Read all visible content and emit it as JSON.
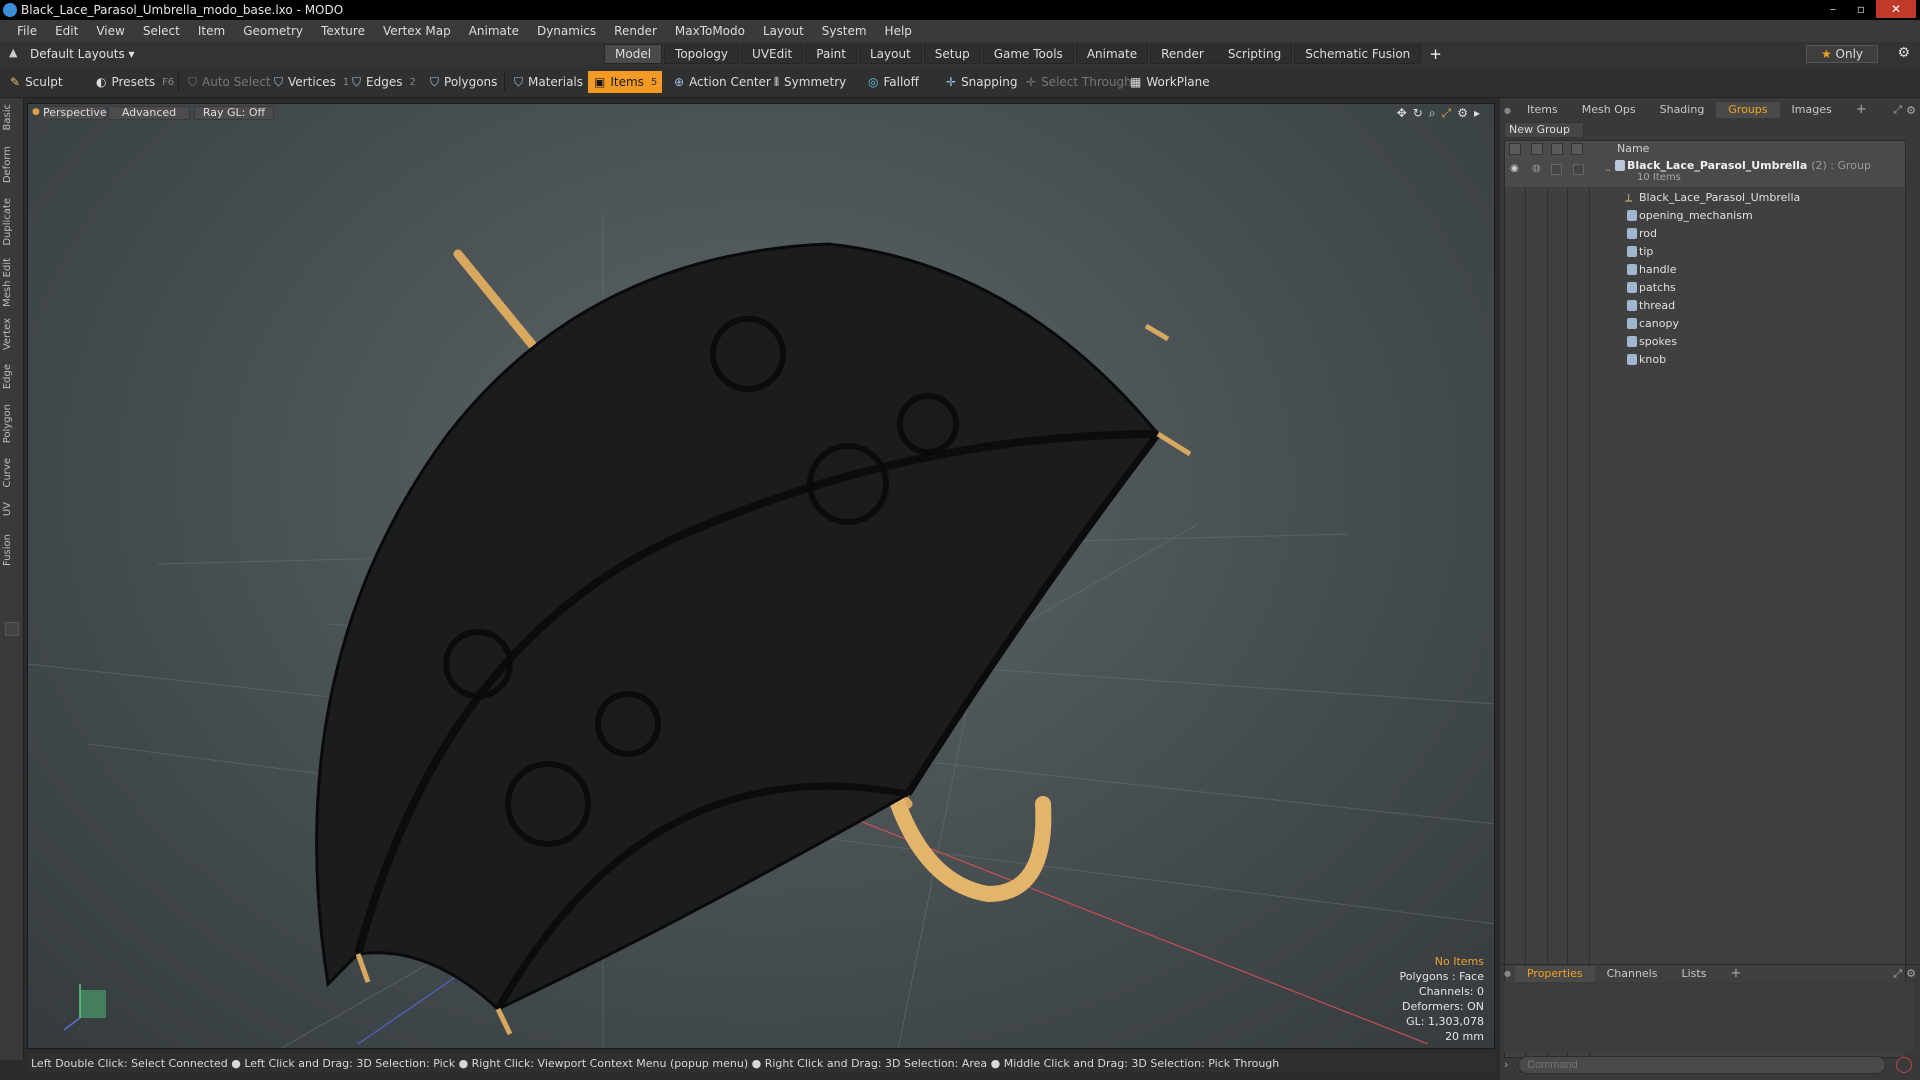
{
  "window": {
    "title": "Black_Lace_Parasol_Umbrella_modo_base.lxo - MODO",
    "controls": [
      "–",
      "▫",
      "✕"
    ]
  },
  "menu": [
    "File",
    "Edit",
    "View",
    "Select",
    "Item",
    "Geometry",
    "Texture",
    "Vertex Map",
    "Animate",
    "Dynamics",
    "Render",
    "MaxToModo",
    "Layout",
    "System",
    "Help"
  ],
  "layout": {
    "selector": "Default Layouts",
    "tabs": [
      "Model",
      "Topology",
      "UVEdit",
      "Paint",
      "Layout",
      "Setup",
      "Game Tools",
      "Animate",
      "Render",
      "Scripting",
      "Schematic Fusion"
    ],
    "active_tab": "Model",
    "plus": "+",
    "only_label": "Only"
  },
  "toolbar": {
    "sculpt": "Sculpt",
    "presets": "Presets",
    "presets_key": "F6",
    "auto_select": "Auto Select",
    "vertices": "Vertices",
    "vertices_count": "1",
    "edges": "Edges",
    "edges_count": "2",
    "polygons": "Polygons",
    "materials": "Materials",
    "items": "Items",
    "items_count": "5",
    "action_center": "Action Center",
    "symmetry": "Symmetry",
    "falloff": "Falloff",
    "snapping": "Snapping",
    "select_through": "Select Through",
    "workplane": "WorkPlane"
  },
  "left_tabs": [
    "Basic",
    "Deform",
    "Duplicate",
    "Mesh Edit",
    "Vertex",
    "Edge",
    "Polygon",
    "Curve",
    "UV",
    "Fusion"
  ],
  "viewport": {
    "view": "Perspective",
    "shading": "Advanced",
    "raygl": "Ray GL: Off",
    "stats": {
      "no_items": "No Items",
      "polygons": "Polygons : Face",
      "channels": "Channels: 0",
      "deformers": "Deformers: ON",
      "gl": "GL: 1,303,078",
      "scale": "20 mm"
    }
  },
  "status": "Left Double Click: Select Connected ● Left Click and Drag: 3D Selection: Pick ● Right Click: Viewport Context Menu (popup menu) ● Right Click and Drag: 3D Selection: Area ● Middle Click and Drag: 3D Selection: Pick Through",
  "panel": {
    "tabs": [
      "Items",
      "Mesh Ops",
      "Shading",
      "Groups",
      "Images"
    ],
    "active_tab": "Groups",
    "plus": "+",
    "new_group": "New Group",
    "name_header": "Name",
    "group": {
      "name": "Black_Lace_Parasol_Umbrella",
      "type": "(2) : Group",
      "count": "10 Items"
    },
    "items": [
      "Black_Lace_Parasol_Umbrella",
      "opening_mechanism",
      "rod",
      "tip",
      "handle",
      "patchs",
      "thread",
      "canopy",
      "spokes",
      "knob"
    ]
  },
  "bottom_panel": {
    "tabs": [
      "Properties",
      "Channels",
      "Lists"
    ],
    "active_tab": "Properties",
    "plus": "+",
    "command_placeholder": "Command"
  },
  "colors": {
    "accent": "#f29a24",
    "active_tab_text": "#f2a21e",
    "canopy": "#1a1a1a",
    "wood": "#e6b66a"
  }
}
